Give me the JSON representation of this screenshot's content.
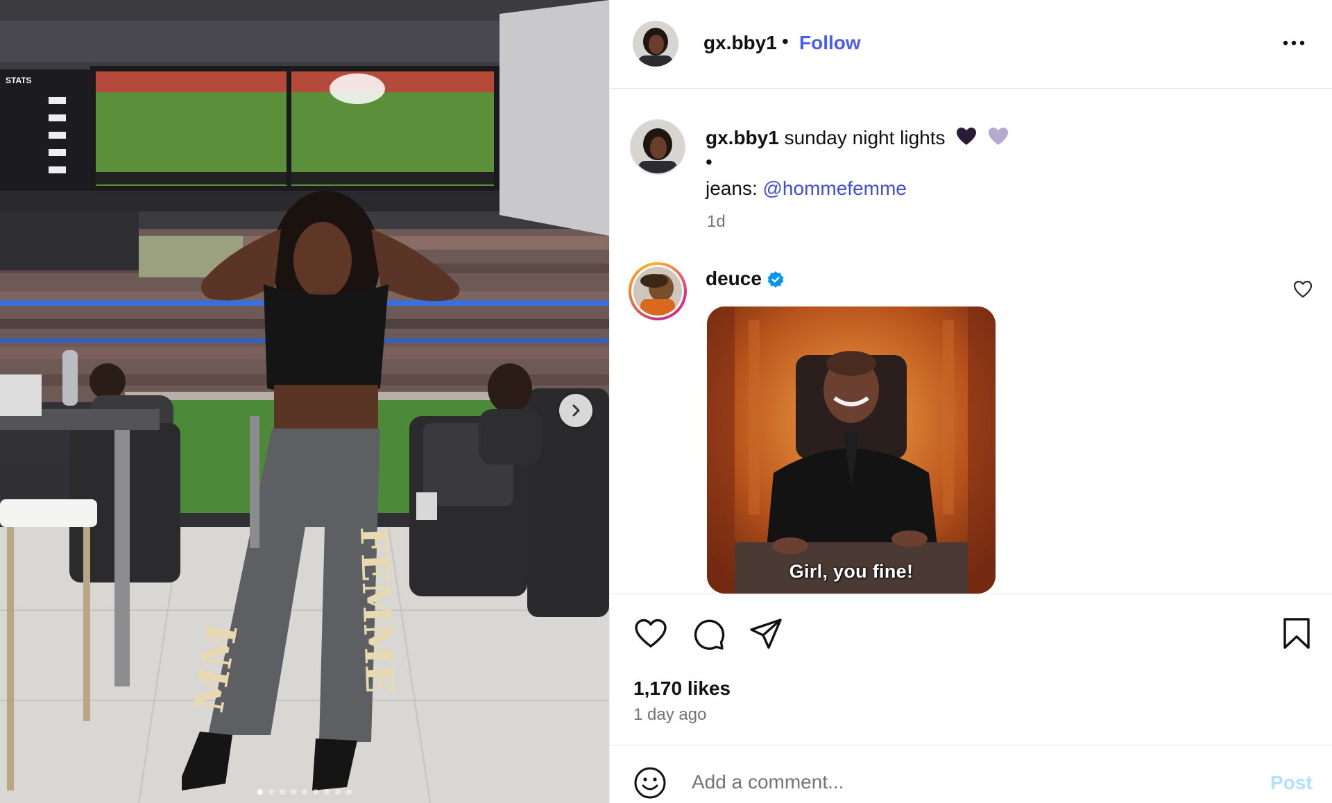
{
  "post": {
    "username": "gx.bby1",
    "separator": "•",
    "follow_label": "Follow",
    "more_icon": "more-horizontal-icon"
  },
  "caption": {
    "username": "gx.bby1",
    "text": "sunday night lights",
    "emoji": [
      "black-heart",
      "light-purple-heart"
    ],
    "bullet": "•",
    "jeans_prefix": "jeans:",
    "mention": "@hommefemme",
    "time": "1d"
  },
  "comment": {
    "username": "deuce",
    "verified": true,
    "gif_text": "Girl, you fine!"
  },
  "actions": {
    "likes": "1,170 likes",
    "posted": "1 day ago"
  },
  "comment_box": {
    "placeholder": "Add a comment...",
    "post_label": "Post"
  },
  "media": {
    "slide_count": 9,
    "active_slide": 1
  },
  "colors": {
    "follow": "#4a5df9",
    "mention": "#3e4fd1",
    "post_disabled": "#b2dffc",
    "verified": "#0095f6",
    "muted": "#737373"
  }
}
